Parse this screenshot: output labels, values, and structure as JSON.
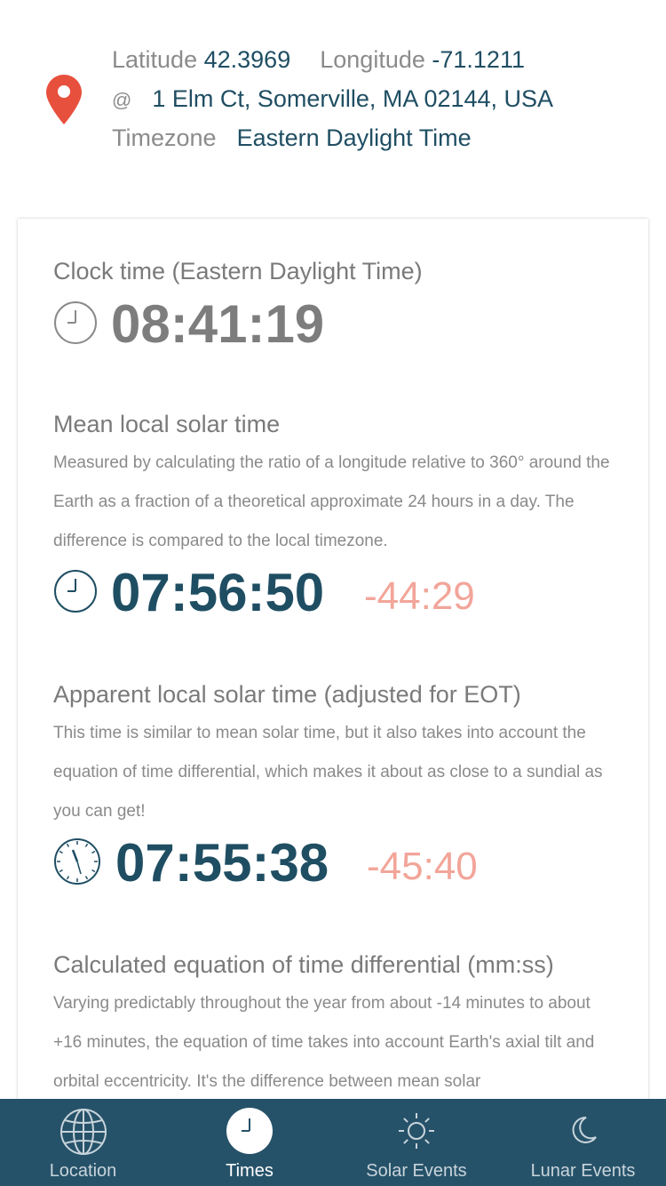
{
  "header": {
    "latitude_label": "Latitude",
    "latitude_value": "42.3969",
    "longitude_label": "Longitude",
    "longitude_value": "-71.1211",
    "at_symbol": "@",
    "address": "1 Elm Ct, Somerville, MA 02144, USA",
    "timezone_label": "Timezone",
    "timezone_value": "Eastern Daylight Time",
    "icon": "map-pin-icon",
    "pin_color": "#e8503e"
  },
  "sections": {
    "clock": {
      "title": "Clock time (Eastern Daylight Time)",
      "time": "08:41:19"
    },
    "mean": {
      "title": "Mean local solar time",
      "description": "Measured by calculating the ratio of a longitude relative to 360° around the Earth as a fraction of a theoretical approximate 24 hours in a day. The difference is compared to the local timezone.",
      "time": "07:56:50",
      "difference": "-44:29"
    },
    "apparent": {
      "title": "Apparent local solar time (adjusted for EOT)",
      "description": "This time is similar to mean solar time, but it also takes into account the equation of time differential, which makes it about as close to a sundial as you can get!",
      "time": "07:55:38",
      "difference": "-45:40"
    },
    "eot": {
      "title": "Calculated equation of time differential (mm:ss)",
      "description": "Varying predictably throughout the year from about -14 minutes to about +16 minutes, the equation of time takes into account Earth's axial tilt and orbital eccentricity. It's the difference between mean solar"
    }
  },
  "tabs": [
    {
      "label": "Location",
      "icon": "globe-icon"
    },
    {
      "label": "Times",
      "icon": "clock-icon"
    },
    {
      "label": "Solar Events",
      "icon": "sun-icon"
    },
    {
      "label": "Lunar Events",
      "icon": "moon-icon"
    }
  ],
  "colors": {
    "accent": "#1f4e63",
    "difference": "#f2a599",
    "tabbar": "#265269",
    "muted_text": "#8a8a8a"
  }
}
